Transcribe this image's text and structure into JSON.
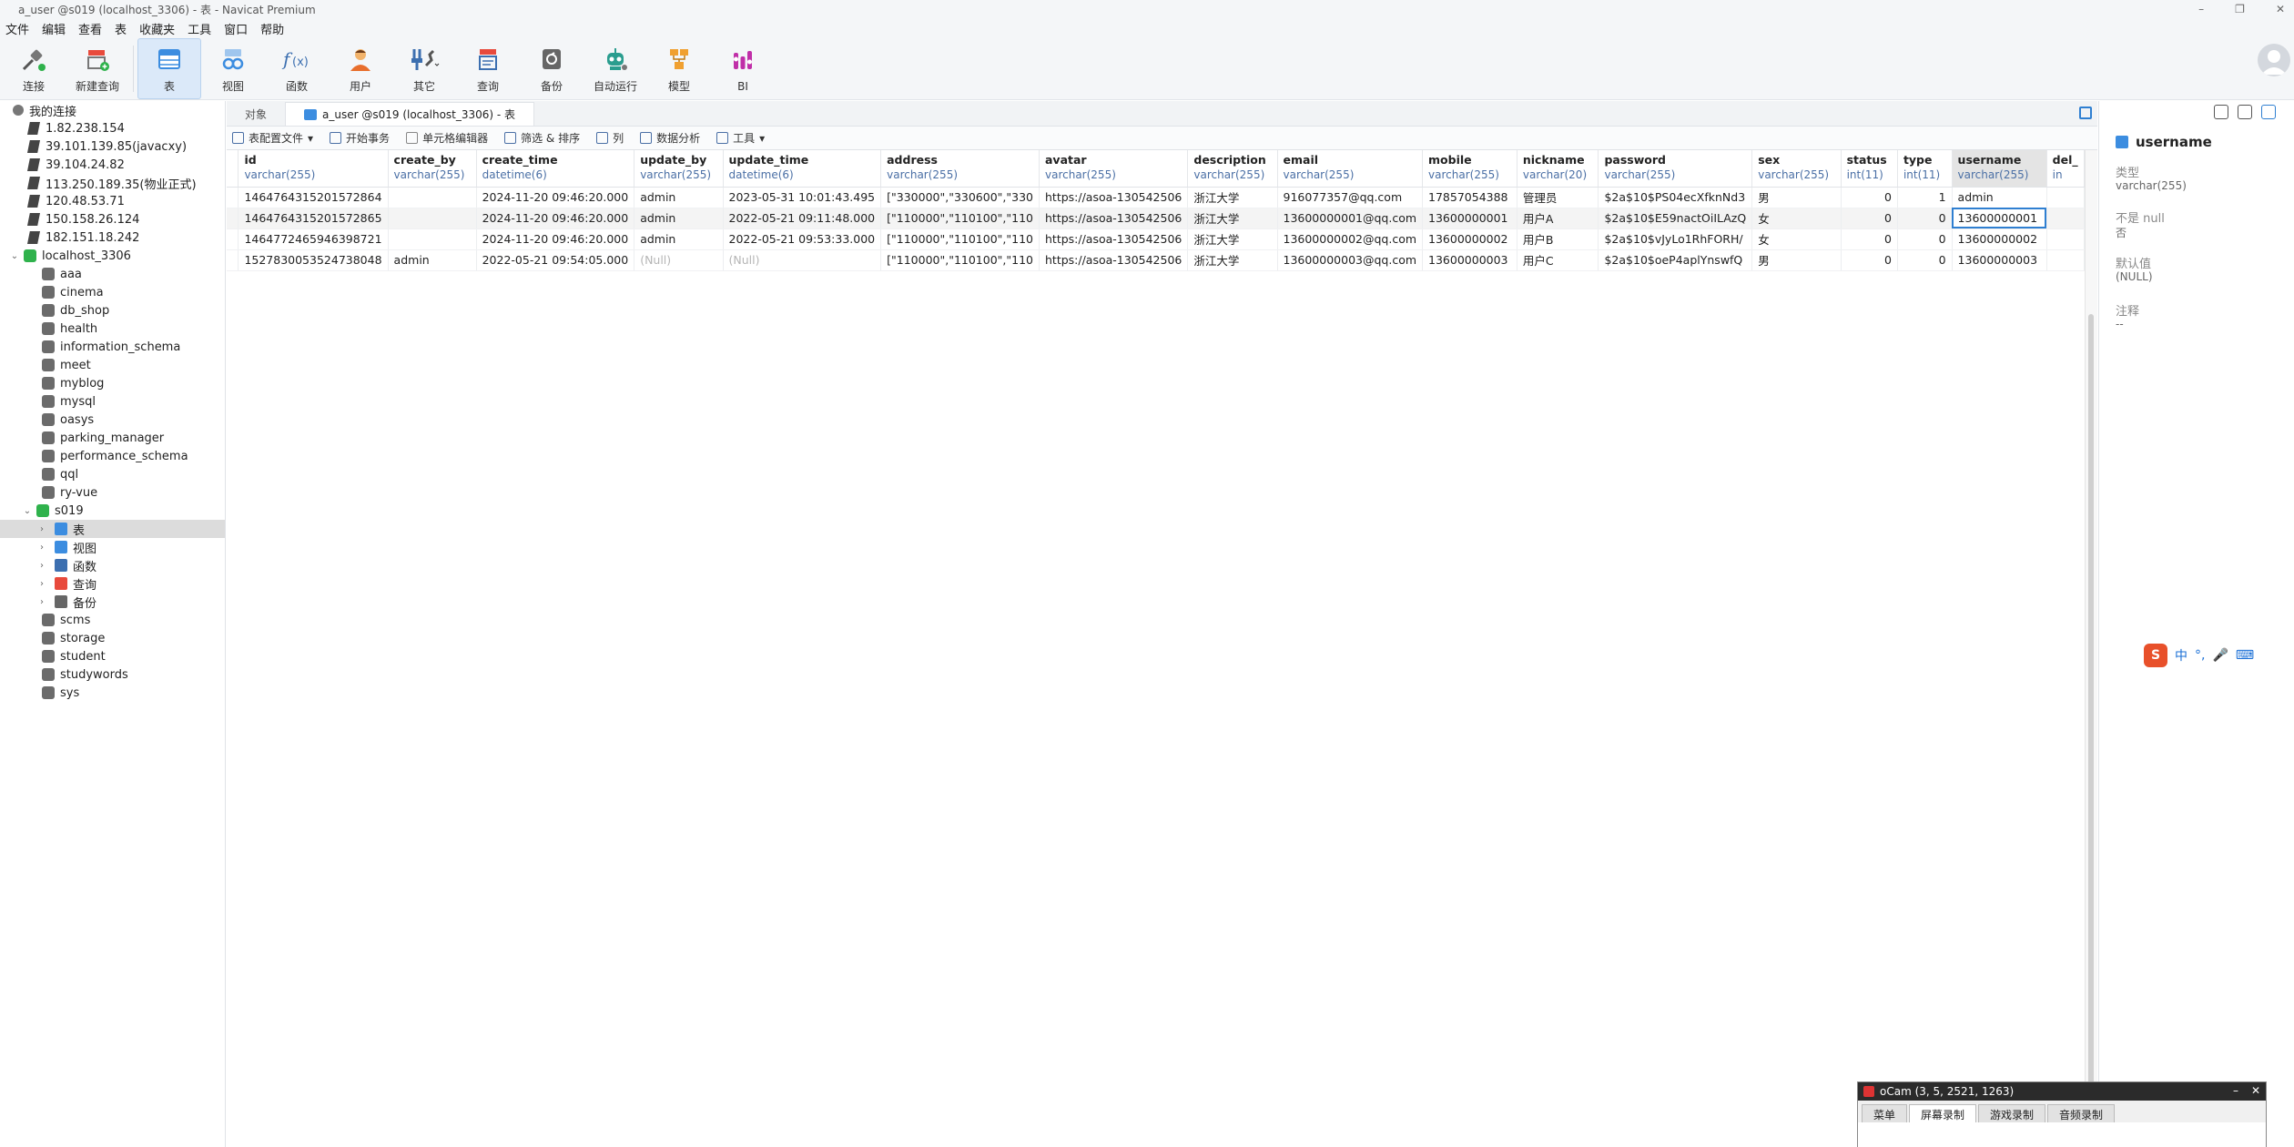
{
  "window": {
    "title": "a_user @s019 (localhost_3306) - 表 - Navicat Premium"
  },
  "menu": [
    "文件",
    "编辑",
    "查看",
    "表",
    "收藏夹",
    "工具",
    "窗口",
    "帮助"
  ],
  "toolbar": {
    "items": [
      {
        "label": "连接",
        "icon": "plug-icon"
      },
      {
        "label": "新建查询",
        "icon": "new-query-icon"
      },
      {
        "label": "表",
        "icon": "table-icon",
        "active": true
      },
      {
        "label": "视图",
        "icon": "view-icon"
      },
      {
        "label": "函数",
        "icon": "function-icon"
      },
      {
        "label": "用户",
        "icon": "user-icon"
      },
      {
        "label": "其它",
        "icon": "tools-icon"
      },
      {
        "label": "查询",
        "icon": "query-icon"
      },
      {
        "label": "备份",
        "icon": "backup-icon"
      },
      {
        "label": "自动运行",
        "icon": "robot-icon"
      },
      {
        "label": "模型",
        "icon": "model-icon"
      },
      {
        "label": "BI",
        "icon": "bi-icon"
      }
    ]
  },
  "sidebar": {
    "root": "我的连接",
    "connections": [
      "1.82.238.154",
      "39.101.139.85(javacxy)",
      "39.104.24.82",
      "113.250.189.35(物业正式)",
      "120.48.53.71",
      "150.158.26.124",
      "182.151.18.242"
    ],
    "local": "localhost_3306",
    "databases_before": [
      "aaa",
      "cinema",
      "db_shop",
      "health",
      "information_schema",
      "meet",
      "myblog",
      "mysql",
      "oasys",
      "parking_manager",
      "performance_schema",
      "qql",
      "ry-vue"
    ],
    "open_db": "s019",
    "open_db_children": [
      "表",
      "视图",
      "函数",
      "查询",
      "备份"
    ],
    "databases_after": [
      "scms",
      "storage",
      "student",
      "studywords",
      "sys"
    ]
  },
  "tabs": {
    "objects": "对象",
    "active": "a_user @s019 (localhost_3306) - 表"
  },
  "subtoolbar": [
    "表配置文件",
    "开始事务",
    "单元格编辑器",
    "筛选 & 排序",
    "列",
    "数据分析",
    "工具"
  ],
  "grid": {
    "columns": [
      {
        "name": "id",
        "type": "varchar(255)"
      },
      {
        "name": "create_by",
        "type": "varchar(255)"
      },
      {
        "name": "create_time",
        "type": "datetime(6)"
      },
      {
        "name": "update_by",
        "type": "varchar(255)"
      },
      {
        "name": "update_time",
        "type": "datetime(6)"
      },
      {
        "name": "address",
        "type": "varchar(255)"
      },
      {
        "name": "avatar",
        "type": "varchar(255)"
      },
      {
        "name": "description",
        "type": "varchar(255)"
      },
      {
        "name": "email",
        "type": "varchar(255)"
      },
      {
        "name": "mobile",
        "type": "varchar(255)"
      },
      {
        "name": "nickname",
        "type": "varchar(20)"
      },
      {
        "name": "password",
        "type": "varchar(255)"
      },
      {
        "name": "sex",
        "type": "varchar(255)"
      },
      {
        "name": "status",
        "type": "int(11)"
      },
      {
        "name": "type",
        "type": "int(11)"
      },
      {
        "name": "username",
        "type": "varchar(255)"
      },
      {
        "name": "del_",
        "type": "in"
      }
    ],
    "rows": [
      [
        "1464764315201572864",
        "",
        "2024-11-20 09:46:20.000",
        "admin",
        "2023-05-31 10:01:43.495",
        "[\"330000\",\"330600\",\"330",
        "https://asoa-130542506",
        "浙江大学",
        "916077357@qq.com",
        "17857054388",
        "管理员",
        "$2a$10$PS04ecXfknNd3",
        "男",
        "0",
        "1",
        "admin",
        ""
      ],
      [
        "1464764315201572865",
        "",
        "2024-11-20 09:46:20.000",
        "admin",
        "2022-05-21 09:11:48.000",
        "[\"110000\",\"110100\",\"110",
        "https://asoa-130542506",
        "浙江大学",
        "13600000001@qq.com",
        "13600000001",
        "用户A",
        "$2a$10$E59nactOiILAzQ",
        "女",
        "0",
        "0",
        "13600000001",
        ""
      ],
      [
        "1464772465946398721",
        "",
        "2024-11-20 09:46:20.000",
        "admin",
        "2022-05-21 09:53:33.000",
        "[\"110000\",\"110100\",\"110",
        "https://asoa-130542506",
        "浙江大学",
        "13600000002@qq.com",
        "13600000002",
        "用户B",
        "$2a$10$vJyLo1RhFORH/",
        "女",
        "0",
        "0",
        "13600000002",
        ""
      ],
      [
        "1527830053524738048",
        "admin",
        "2022-05-21 09:54:05.000",
        "(Null)",
        "(Null)",
        "[\"110000\",\"110100\",\"110",
        "https://asoa-130542506",
        "浙江大学",
        "13600000003@qq.com",
        "13600000003",
        "用户C",
        "$2a$10$oeP4aplYnswfQ",
        "男",
        "0",
        "0",
        "13600000003",
        ""
      ]
    ]
  },
  "properties": {
    "field": "username",
    "type_label": "类型",
    "type_value": "varchar(255)",
    "notnull_label": "不是 null",
    "notnull_value": "否",
    "default_label": "默认值",
    "default_value": "(NULL)",
    "comment_label": "注释",
    "comment_value": "--"
  },
  "ime": {
    "mode": "中",
    "punct": "°,"
  },
  "ocam": {
    "title": "oCam (3, 5, 2521, 1263)",
    "tabs": [
      "菜单",
      "屏幕录制",
      "游戏录制",
      "音频录制"
    ]
  }
}
